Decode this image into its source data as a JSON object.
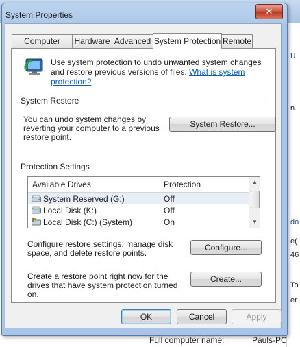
{
  "background": {
    "right_fragments": [
      "u",
      "n.",
      "do",
      "e(",
      "46",
      "To",
      "er"
    ],
    "full_computer_name_label": "Full computer name:",
    "full_computer_name_value": "Pauls-PC"
  },
  "dialog": {
    "title": "System Properties",
    "close_label": "✕",
    "tabs": [
      {
        "label": "Computer Name"
      },
      {
        "label": "Hardware"
      },
      {
        "label": "Advanced"
      },
      {
        "label": "System Protection"
      },
      {
        "label": "Remote"
      }
    ],
    "intro_text": "Use system protection to undo unwanted system changes and restore previous versions of files.",
    "intro_link": "What is system protection?",
    "system_restore": {
      "heading": "System Restore",
      "description": "You can undo system changes by reverting your computer to a previous restore point.",
      "button": "System Restore..."
    },
    "protection_settings": {
      "heading": "Protection Settings",
      "columns": [
        "Available Drives",
        "Protection"
      ],
      "drives": [
        {
          "name": "System Reserved (G:)",
          "protection": "Off"
        },
        {
          "name": "Local Disk (K:)",
          "protection": "Off"
        },
        {
          "name": "Local Disk (C:) (System)",
          "protection": "On"
        }
      ],
      "configure_text": "Configure restore settings, manage disk space, and delete restore points.",
      "configure_button": "Configure...",
      "create_text": "Create a restore point right now for the drives that have system protection turned on.",
      "create_button": "Create..."
    },
    "footer": {
      "ok": "OK",
      "cancel": "Cancel",
      "apply": "Apply"
    }
  },
  "colors": {
    "link": "#0f5fb6",
    "close_button": "#c9513e",
    "titlebar": "#a8c4e6"
  }
}
